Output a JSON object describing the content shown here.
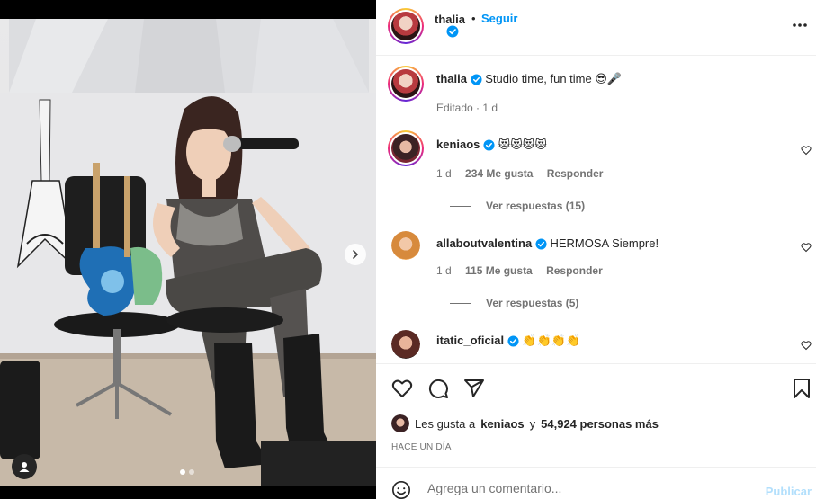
{
  "header": {
    "username": "thalia",
    "separator": "•",
    "follow_label": "Seguir",
    "more_icon": "more-horizontal-icon"
  },
  "caption": {
    "username": "thalia",
    "text": "Studio time, fun time",
    "emojis": "😎🎤",
    "meta": "Editado · 1 d"
  },
  "comments": [
    {
      "username": "keniaos",
      "text": "😻😻😻😻",
      "age": "1 d",
      "likes": "234 Me gusta",
      "reply_label": "Responder",
      "view_replies": "Ver respuestas (15)"
    },
    {
      "username": "allaboutvalentina",
      "text": "HERMOSA Siempre!",
      "age": "1 d",
      "likes": "115 Me gusta",
      "reply_label": "Responder",
      "view_replies": "Ver respuestas (5)"
    },
    {
      "username": "itatic_oficial",
      "text": "👏👏👏👏"
    }
  ],
  "likes_line": {
    "prefix": "Les gusta a",
    "user": "keniaos",
    "connector": "y",
    "count": "54,924 personas más"
  },
  "timestamp": "HACE UN DÍA",
  "composer": {
    "placeholder": "Agrega un comentario...",
    "publish_label": "Publicar"
  },
  "carousel": {
    "current": 1,
    "total": 2
  },
  "colors": {
    "accent": "#0095f6",
    "publish_disabled": "#b2dffc",
    "verified": "#0095f6",
    "muted": "#737373"
  }
}
